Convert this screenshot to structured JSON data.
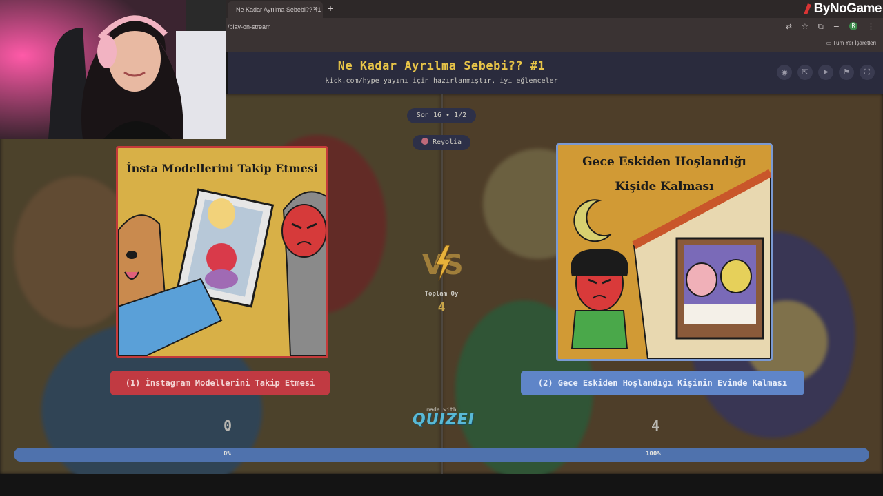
{
  "browser": {
    "tab_title": "Ne Kadar Ayrılma Sebebi?? #1",
    "tab_close": "×",
    "new_tab": "+",
    "url": "/play-on-stream",
    "bookmarks_label": "Tüm Yer İşaretleri",
    "profile_initial": "R"
  },
  "brand": {
    "name": "ByNoGame"
  },
  "header": {
    "title": "Ne Kadar Ayrılma Sebebi?? #1",
    "subtitle": "kick.com/hype yayını için hazırlanmıştır, iyi eğlenceler",
    "icons": [
      "eye-icon",
      "share-icon",
      "send-icon",
      "flag-icon",
      "fullscreen-icon"
    ]
  },
  "round": {
    "label": "Son 16 • 1/2"
  },
  "user": {
    "name": "Reyolia"
  },
  "left_option": {
    "card_title": "İnsta Modellerini Takip Etmesi",
    "button_label": "(1) İnstagram Modellerini Takip Etmesi",
    "votes": "0",
    "percent_label": "0%",
    "percent": 0,
    "color": "#c13a42"
  },
  "right_option": {
    "card_title_line1": "Gece Eskiden Hoşlandığı",
    "card_title_line2": "Kişide Kalması",
    "button_label": "(2) Gece Eskiden Hoşlandığı Kişinin Evinde Kalması",
    "votes": "4",
    "percent_label": "100%",
    "percent": 100,
    "color": "#5f85c8"
  },
  "total": {
    "label": "Toplam Oy",
    "value": "4"
  },
  "footer": {
    "made_with": "made with",
    "logo_text": "QUIZEI"
  }
}
